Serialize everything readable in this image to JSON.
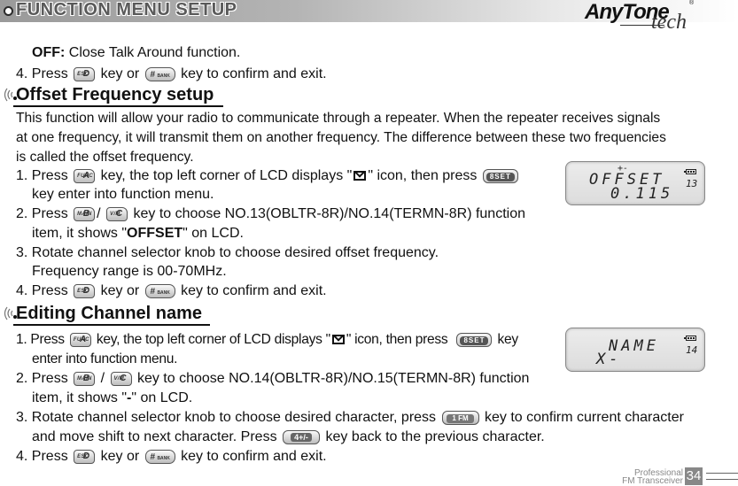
{
  "header": {
    "title": "FUNCTION MENU SETUP",
    "logo_brand": "AnyTone",
    "logo_sub": "tech",
    "logo_reg": "®"
  },
  "intro": {
    "off_label": "OFF:",
    "off_text": " Close Talk Around function.",
    "step4_prefix": "4. Press",
    "step4_mid": "key or",
    "step4_suffix": "key to confirm and exit."
  },
  "keys": {
    "esc": {
      "top": "D",
      "bottom": "ESC"
    },
    "bank": {
      "main": "#",
      "sub": "BANK"
    },
    "func": {
      "top": "A",
      "bottom": "FUNC"
    },
    "main": {
      "top": "B",
      "bottom": "MAIN"
    },
    "vm": {
      "top": "C",
      "bottom": "V/M"
    },
    "set": {
      "label": "8SET"
    },
    "fm": {
      "label": "1 FM"
    },
    "plusminus": {
      "label": "4+/-"
    }
  },
  "offset_section": {
    "title": "Offset Frequency setup",
    "description_lines": [
      "This function will allow your radio to communicate through a repeater. When the repeater receives signals",
      "at one frequency, it will transmit them on another frequency. The difference between these two frequencies",
      "is called the offset frequency."
    ],
    "step1_a": "1. Press",
    "step1_b": "key, the top left corner of LCD displays \"",
    "step1_c": "\" icon, then press",
    "step1_d": "key enter into function menu.",
    "step2_a": "2. Press",
    "step2_slash": "/",
    "step2_b": "key to choose NO.13(OBLTR-8R)/NO.14(TERMN-8R) function",
    "step2_c": "item, it shows \"",
    "step2_bold": "OFFSET",
    "step2_d": "\" on LCD.",
    "step3_a": "3. Rotate channel selector knob to choose desired offset frequency.",
    "step3_b": "Frequency range is 00-70MHz.",
    "step4_prefix": "4. Press",
    "step4_mid": "key or",
    "step4_suffix": "key to confirm and exit.",
    "lcd": {
      "indicator": "+-",
      "line1": "OFFSET",
      "line2": "0.115",
      "channel": "13"
    }
  },
  "channel_section": {
    "title": "Editing Channel name",
    "step1_a": "1. Press",
    "step1_b": "key, the top left corner of LCD displays \"",
    "step1_c": "\" icon, then press",
    "step1_d": "key",
    "step1_e": "enter into function menu.",
    "step2_a": "2. Press",
    "step2_slash": "/",
    "step2_b": "key to choose NO.14(OBLTR-8R)/NO.15(TERMN-8R) function",
    "step2_c": "item, it shows \"",
    "step2_bold": "-",
    "step2_d": "\" on LCD.",
    "step3_a": "3. Rotate channel selector knob to choose desired character, press",
    "step3_b": "key to confirm current character",
    "step3_c": "and move shift to next character. Press",
    "step3_d": "key back to the previous character.",
    "step4_prefix": "4. Press",
    "step4_mid": "key or",
    "step4_suffix": "key to confirm and exit.",
    "lcd": {
      "line1": "NAME",
      "line2": "X-",
      "channel": "14"
    }
  },
  "footer": {
    "line1": "Professional",
    "line2": "FM Transceiver",
    "page_number": "34"
  }
}
